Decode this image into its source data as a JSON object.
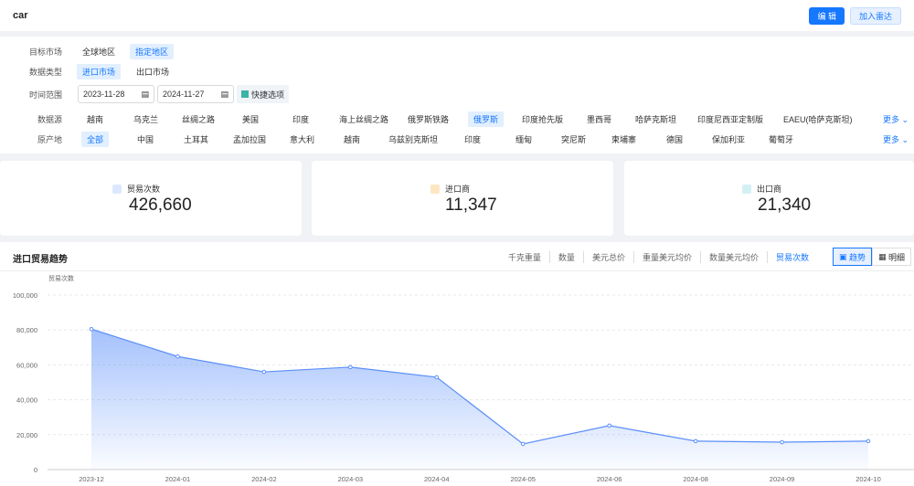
{
  "header": {
    "title": "car",
    "edit": "编 辑",
    "add_radar": "加入雷达"
  },
  "filters": {
    "target_market": {
      "label": "目标市场",
      "options": [
        "全球地区",
        "指定地区"
      ],
      "selected": 1
    },
    "data_type": {
      "label": "数据类型",
      "options": [
        "进口市场",
        "出口市场"
      ],
      "selected": 0
    },
    "time_range": {
      "label": "时间范围",
      "start": "2023-11-28",
      "end": "2024-11-27",
      "quick": "快捷选项"
    },
    "source": {
      "label": "数据源",
      "options": [
        "越南",
        "乌克兰",
        "丝绸之路",
        "美国",
        "印度",
        "海上丝绸之路",
        "俄罗斯铁路",
        "俄罗斯",
        "印度抢先版",
        "墨西哥",
        "哈萨克斯坦",
        "印度尼西亚定制版",
        "EAEU(哈萨克斯坦)"
      ],
      "selected": 7,
      "more": "更多"
    },
    "origin": {
      "label": "原产地",
      "options": [
        "全部",
        "中国",
        "土耳其",
        "孟加拉国",
        "意大利",
        "越南",
        "乌兹别克斯坦",
        "印度",
        "缅甸",
        "突尼斯",
        "柬埔寨",
        "德国",
        "保加利亚",
        "葡萄牙"
      ],
      "selected": 0,
      "more": "更多"
    }
  },
  "stats": [
    {
      "label": "贸易次数",
      "value": "426,660",
      "icon": "bar-chart-icon",
      "color": "#1677ff"
    },
    {
      "label": "进口商",
      "value": "11,347",
      "icon": "importer-icon",
      "color": "#f5a623"
    },
    {
      "label": "出口商",
      "value": "21,340",
      "icon": "exporter-icon",
      "color": "#3bb3c9"
    }
  ],
  "trend": {
    "title": "进口贸易趋势",
    "metrics": [
      "千克重量",
      "数量",
      "美元总价",
      "重量美元均价",
      "数量美元均价",
      "贸易次数"
    ],
    "active_metric": 5,
    "views": [
      "趋势",
      "明细"
    ],
    "active_view": 0
  },
  "chart_data": {
    "type": "area",
    "ylabel": "贸易次数",
    "ylim": [
      0,
      100000
    ],
    "yticks": [
      "0",
      "20,000",
      "40,000",
      "60,000",
      "80,000",
      "100,000"
    ],
    "categories": [
      "2023-12",
      "2024-01",
      "2024-02",
      "2024-03",
      "2024-04",
      "2024-05",
      "2024-06",
      "2024-08",
      "2024-09",
      "2024-10"
    ],
    "values": [
      80500,
      64800,
      56000,
      58700,
      52900,
      14700,
      25200,
      16300,
      15700,
      16300
    ],
    "color": "#5b8ff9",
    "grid": true
  }
}
